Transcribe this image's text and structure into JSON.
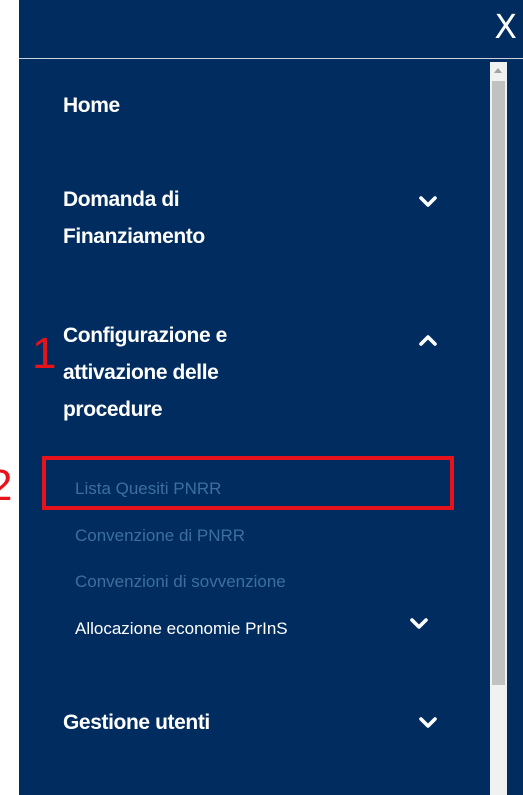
{
  "close_label": "X",
  "menu": {
    "home": "Home",
    "domanda_line1": "Domanda di",
    "domanda_line2": "Finanziamento",
    "config_line1": "Configurazione e",
    "config_line2": "attivazione delle",
    "config_line3": "procedure",
    "gestione": "Gestione utenti"
  },
  "submenu": {
    "items": [
      {
        "label": "Lista Quesiti PNRR"
      },
      {
        "label": "Convenzione di PNRR"
      },
      {
        "label": "Convenzioni di sovvenzione"
      },
      {
        "label": "Allocazione economie PrInS"
      }
    ]
  },
  "annotations": {
    "step1": "1",
    "step2": "2"
  },
  "icons": {
    "close": "close-icon",
    "expand": "chevron-down-icon",
    "collapse": "chevron-up-icon"
  },
  "colors": {
    "panel_bg": "#012c5f",
    "submenu_text": "#3c6f9e",
    "annotation": "#e8131a"
  }
}
